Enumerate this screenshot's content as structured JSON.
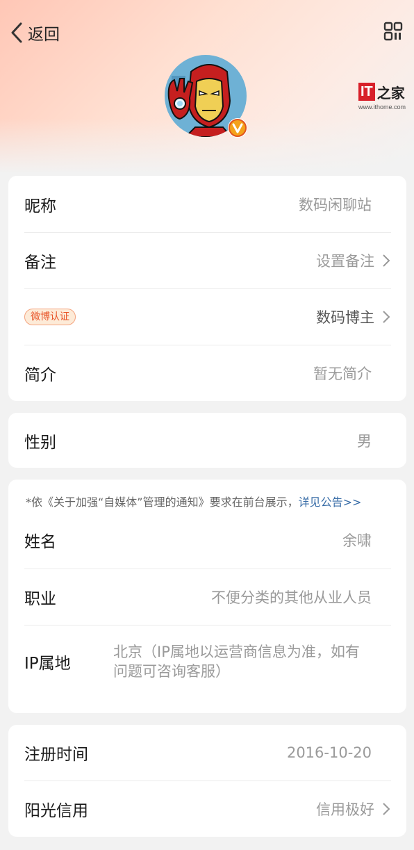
{
  "nav": {
    "back_label": "返回",
    "qr_icon": "qr-code-icon"
  },
  "profile": {
    "avatar_icon": "iron-man-avatar",
    "verified_icon": "verified-v-badge"
  },
  "watermark": {
    "brand": "IT",
    "brand_zh": "之家",
    "url": "www.ithome.com"
  },
  "basic": {
    "nickname_label": "昵称",
    "nickname_value": "数码闲聊站",
    "remark_label": "备注",
    "remark_value": "设置备注",
    "verify_badge": "微博认证",
    "verify_value": "数码博主",
    "intro_label": "简介",
    "intro_value": "暂无简介"
  },
  "gender": {
    "label": "性别",
    "value": "男"
  },
  "realname": {
    "notice_text": "*依《关于加强“自媒体”管理的通知》要求在前台展示，",
    "notice_link": "详见公告>>",
    "name_label": "姓名",
    "name_value": "余啸",
    "job_label": "职业",
    "job_value": "不便分类的其他从业人员",
    "ip_label": "IP属地",
    "ip_value": "北京（IP属地以运营商信息为准，如有问题可咨询客服）"
  },
  "account": {
    "reg_label": "注册时间",
    "reg_value": "2016-10-20",
    "credit_label": "阳光信用",
    "credit_value": "信用极好"
  },
  "colors": {
    "accent": "#e8562a",
    "link": "#3a6ea8",
    "brand_red": "#d8202a"
  }
}
